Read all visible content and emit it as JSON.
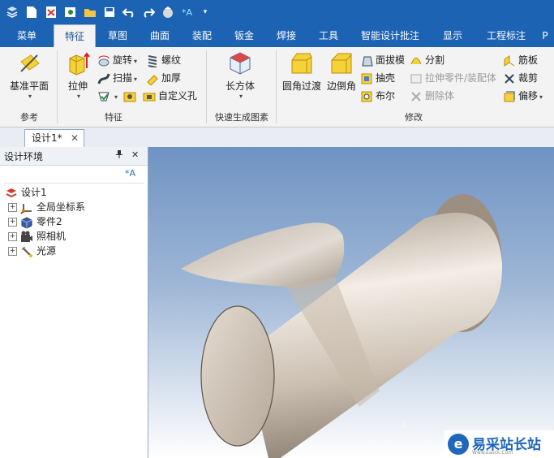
{
  "tabs": [
    "菜单",
    "特征",
    "草图",
    "曲面",
    "装配",
    "钣金",
    "焊接",
    "工具",
    "智能设计批注",
    "显示",
    "工程标注"
  ],
  "active_tab": "特征",
  "ribbon": {
    "ref_group": {
      "label": "参考",
      "datum_plane": "基准平面"
    },
    "feature_group": {
      "label": "特征",
      "extrude": "拉伸",
      "revolve": "旋转",
      "sweep": "扫描",
      "thread": "螺纹",
      "thicken": "加厚",
      "custom_hole": "自定义孔"
    },
    "quick_group": {
      "label": "快速生成图素",
      "box": "长方体"
    },
    "modify_group": {
      "label": "修改",
      "fillet": "圆角过渡",
      "chamfer": "边倒角",
      "draft": "面拔模",
      "shell": "抽壳",
      "boolean": "布尔",
      "split": "分割",
      "stretch": "拉伸零件/装配体",
      "delete_body": "删除体",
      "rib": "筋板",
      "trim": "裁剪",
      "offset": "偏移"
    }
  },
  "doc_tab": {
    "title": "设计1*",
    "close": "✕"
  },
  "panel": {
    "title": "设计环境",
    "pin": "ᵖ",
    "close": "✕",
    "tree": {
      "root": "设计1",
      "items": [
        "全局坐标系",
        "零件2",
        "照相机",
        "光源"
      ]
    }
  },
  "watermark": {
    "text": "易采站长站",
    "sub": "Www.Easck.Com"
  },
  "colors": {
    "titlebar": "#1d63b4",
    "ribbon": "#f3f3f3",
    "viewport_top": "#6f93c2",
    "part": "#cfc4b6"
  }
}
